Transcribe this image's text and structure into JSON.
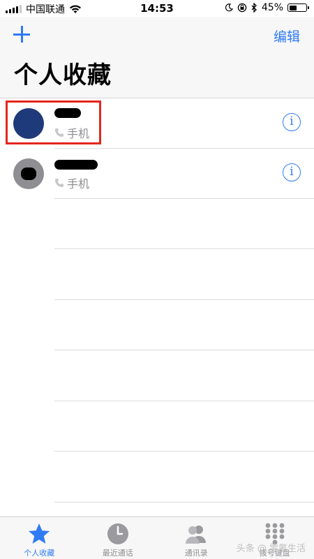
{
  "status_bar": {
    "carrier": "中国联通",
    "time": "14:53",
    "battery": "45%",
    "battery_level": 0.45
  },
  "header": {
    "edit_label": "编辑",
    "title": "个人收藏"
  },
  "favorites": [
    {
      "type_label": "手机",
      "avatar_color": "#1f3a7a"
    },
    {
      "type_label": "手机",
      "avatar_color": "#8e8e93"
    }
  ],
  "tabbar": {
    "items": [
      {
        "label": "个人收藏",
        "icon": "star-icon",
        "active": true
      },
      {
        "label": "最近通话",
        "icon": "clock-icon",
        "active": false
      },
      {
        "label": "通讯录",
        "icon": "contacts-icon",
        "active": false
      },
      {
        "label": "拨号键盘",
        "icon": "keypad-icon",
        "active": false
      }
    ]
  },
  "watermark": "头条 @ 零氪生活",
  "colors": {
    "accent": "#2f7bf5",
    "highlight_box": "#e5261c",
    "secondary_text": "#8e8e93"
  }
}
